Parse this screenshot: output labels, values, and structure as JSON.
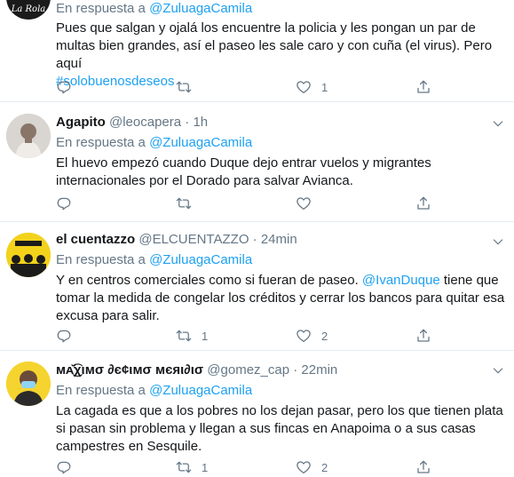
{
  "tweets": [
    {
      "name": "",
      "handle": "",
      "time": "",
      "reply_prefix": "En respuesta a",
      "reply_to": "@ZuluagaCamila",
      "lines": [
        "Pues que salgan y ojalá los encuentre la policia y les pongan un par de",
        "multas bien grandes, así el paseo les sale caro y con cuña (el virus). Pero aquí"
      ],
      "hashtag": "#solobuenosdeseos",
      "replies": "",
      "retweets": "",
      "likes": "1",
      "avatar_text": "La Rola",
      "avatar_color": "#1b1b1b"
    },
    {
      "name": "Agapito",
      "handle": "@leocapera",
      "time": "1h",
      "reply_prefix": "En respuesta a",
      "reply_to": "@ZuluagaCamila",
      "lines": [
        "El huevo empezó cuando Duque dejo entrar vuelos y migrantes",
        "internacionales por el Dorado para salvar Avianca."
      ],
      "replies": "",
      "retweets": "",
      "likes": "",
      "avatar_color": "#c7c2bd"
    },
    {
      "name": "el cuentazzo",
      "handle": "@ELCUENTAZZO",
      "time": "24min",
      "reply_prefix": "En respuesta a",
      "reply_to": "@ZuluagaCamila",
      "line1_pre": "Y en centros comerciales como si fueran de paseo.",
      "line1_mention": "@IvanDuque",
      "line1_post": "tiene que",
      "lines": [
        "tomar la medida de congelar los créditos y cerrar los bancos para quitar esa",
        "excusa para salir."
      ],
      "replies": "",
      "retweets": "1",
      "likes": "2",
      "avatar_color": "#f2d21b"
    },
    {
      "name": "ᴍᴀ̆͜͡χιмσ ∂є¢ιмσ мєяι∂ισ",
      "handle": "@gomez_cap",
      "time": "22min",
      "reply_prefix": "En respuesta a",
      "reply_to": "@ZuluagaCamila",
      "lines": [
        "La cagada es que a los pobres no los dejan pasar, pero los que tienen plata",
        "si pasan sin problema y llegan a sus fincas en Anapoima o a sus casas",
        "campestres en Sesquile."
      ],
      "replies": "",
      "retweets": "1",
      "likes": "2",
      "avatar_color": "#f5d430"
    }
  ],
  "colors": {
    "link": "#1da1f2",
    "muted": "#657786",
    "text": "#14171a",
    "border": "#e6ecf0"
  },
  "icons": [
    "reply-icon",
    "retweet-icon",
    "like-icon",
    "share-icon",
    "more-caret-icon"
  ]
}
